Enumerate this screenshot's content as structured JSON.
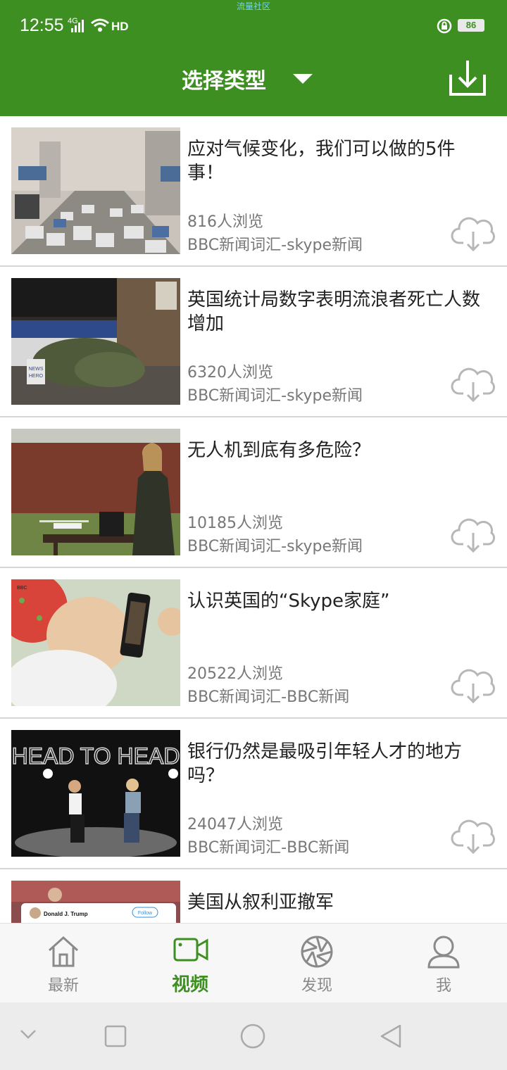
{
  "status_bar": {
    "time": "12:55",
    "network": "4G",
    "hd": "HD",
    "carrier_text": "流量社区",
    "battery": "86"
  },
  "header": {
    "title": "选择类型"
  },
  "articles": [
    {
      "title": "应对气候变化，我们可以做的5件事！",
      "views": "816人浏览",
      "source": "BBC新闻词汇-skype新闻"
    },
    {
      "title": "英国统计局数字表明流浪者死亡人数增加",
      "views": "6320人浏览",
      "source": "BBC新闻词汇-skype新闻"
    },
    {
      "title": "无人机到底有多危险？",
      "views": "10185人浏览",
      "source": "BBC新闻词汇-skype新闻"
    },
    {
      "title": "认识英国的“Skype家庭”",
      "views": "20522人浏览",
      "source": "BBC新闻词汇-BBC新闻"
    },
    {
      "title": "银行仍然是最吸引年轻人才的地方吗？",
      "views": "24047人浏览",
      "source": "BBC新闻词汇-BBC新闻"
    },
    {
      "title": "美国从叙利亚撤军",
      "views": "",
      "source": ""
    }
  ],
  "thumb_texts": {
    "bus_stop_sign": "NEWS\nHERO",
    "head_to_head": "HEAD TO HEAD",
    "trump_name": "Donald J. Trump",
    "follow": "Follow"
  },
  "tabs": [
    {
      "label": "最新",
      "icon": "home-icon",
      "active": false
    },
    {
      "label": "视频",
      "icon": "video-camera-icon",
      "active": true
    },
    {
      "label": "发现",
      "icon": "aperture-icon",
      "active": false
    },
    {
      "label": "我",
      "icon": "user-icon",
      "active": false
    }
  ],
  "colors": {
    "brand_green": "#3e8f22",
    "text_dark": "#222222",
    "text_gray": "#777777"
  }
}
